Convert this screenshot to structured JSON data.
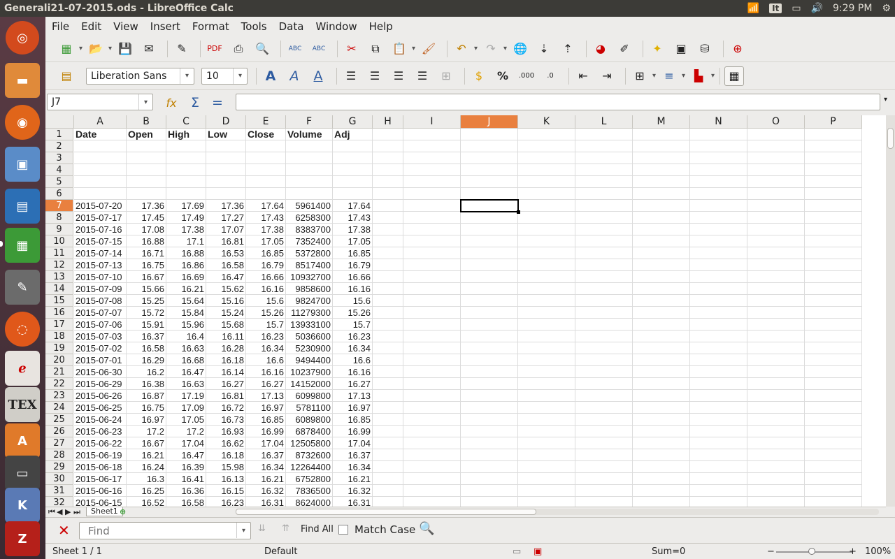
{
  "window": {
    "title": "Generali21-07-2015.ods - LibreOffice Calc",
    "tray": {
      "keyboard": "It",
      "clock": "9:29 PM"
    }
  },
  "menu": [
    "File",
    "Edit",
    "View",
    "Insert",
    "Format",
    "Tools",
    "Data",
    "Window",
    "Help"
  ],
  "format_bar": {
    "font_name": "Liberation Sans",
    "font_size": "10"
  },
  "name_box": "J7",
  "formula": "",
  "columns": [
    "A",
    "B",
    "C",
    "D",
    "E",
    "F",
    "G",
    "H",
    "I",
    "J",
    "K",
    "L",
    "M",
    "N",
    "O",
    "P"
  ],
  "selected_column": "J",
  "selected_row": 7,
  "header_row": [
    "Date",
    "Open",
    "High",
    "Low",
    "Close",
    "Volume",
    "Adj"
  ],
  "row_numbers": [
    1,
    2,
    3,
    4,
    5,
    6,
    7,
    8,
    9,
    10,
    11,
    12,
    13,
    14,
    15,
    16,
    17,
    18,
    19,
    20,
    21,
    22,
    23,
    24,
    25,
    26,
    27,
    28,
    29,
    30,
    31,
    32
  ],
  "data_rows": [
    [
      "2015-07-20",
      "17.36",
      "17.69",
      "17.36",
      "17.64",
      "5961400",
      "17.64"
    ],
    [
      "2015-07-17",
      "17.45",
      "17.49",
      "17.27",
      "17.43",
      "6258300",
      "17.43"
    ],
    [
      "2015-07-16",
      "17.08",
      "17.38",
      "17.07",
      "17.38",
      "8383700",
      "17.38"
    ],
    [
      "2015-07-15",
      "16.88",
      "17.1",
      "16.81",
      "17.05",
      "7352400",
      "17.05"
    ],
    [
      "2015-07-14",
      "16.71",
      "16.88",
      "16.53",
      "16.85",
      "5372800",
      "16.85"
    ],
    [
      "2015-07-13",
      "16.75",
      "16.86",
      "16.58",
      "16.79",
      "8517400",
      "16.79"
    ],
    [
      "2015-07-10",
      "16.67",
      "16.69",
      "16.47",
      "16.66",
      "10932700",
      "16.66"
    ],
    [
      "2015-07-09",
      "15.66",
      "16.21",
      "15.62",
      "16.16",
      "9858600",
      "16.16"
    ],
    [
      "2015-07-08",
      "15.25",
      "15.64",
      "15.16",
      "15.6",
      "9824700",
      "15.6"
    ],
    [
      "2015-07-07",
      "15.72",
      "15.84",
      "15.24",
      "15.26",
      "11279300",
      "15.26"
    ],
    [
      "2015-07-06",
      "15.91",
      "15.96",
      "15.68",
      "15.7",
      "13933100",
      "15.7"
    ],
    [
      "2015-07-03",
      "16.37",
      "16.4",
      "16.11",
      "16.23",
      "5036600",
      "16.23"
    ],
    [
      "2015-07-02",
      "16.58",
      "16.63",
      "16.28",
      "16.34",
      "5230900",
      "16.34"
    ],
    [
      "2015-07-01",
      "16.29",
      "16.68",
      "16.18",
      "16.6",
      "9494400",
      "16.6"
    ],
    [
      "2015-06-30",
      "16.2",
      "16.47",
      "16.14",
      "16.16",
      "10237900",
      "16.16"
    ],
    [
      "2015-06-29",
      "16.38",
      "16.63",
      "16.27",
      "16.27",
      "14152000",
      "16.27"
    ],
    [
      "2015-06-26",
      "16.87",
      "17.19",
      "16.81",
      "17.13",
      "6099800",
      "17.13"
    ],
    [
      "2015-06-25",
      "16.75",
      "17.09",
      "16.72",
      "16.97",
      "5781100",
      "16.97"
    ],
    [
      "2015-06-24",
      "16.97",
      "17.05",
      "16.73",
      "16.85",
      "6089800",
      "16.85"
    ],
    [
      "2015-06-23",
      "17.2",
      "17.2",
      "16.93",
      "16.99",
      "6878400",
      "16.99"
    ],
    [
      "2015-06-22",
      "16.67",
      "17.04",
      "16.62",
      "17.04",
      "12505800",
      "17.04"
    ],
    [
      "2015-06-19",
      "16.21",
      "16.47",
      "16.18",
      "16.37",
      "8732600",
      "16.37"
    ],
    [
      "2015-06-18",
      "16.24",
      "16.39",
      "15.98",
      "16.34",
      "12264400",
      "16.34"
    ],
    [
      "2015-06-17",
      "16.3",
      "16.41",
      "16.13",
      "16.21",
      "6752800",
      "16.21"
    ],
    [
      "2015-06-16",
      "16.25",
      "16.36",
      "16.15",
      "16.32",
      "7836500",
      "16.32"
    ],
    [
      "2015-06-15",
      "16.52",
      "16.58",
      "16.23",
      "16.31",
      "8624000",
      "16.31"
    ]
  ],
  "sheet_tab": "Sheet1",
  "find_bar": {
    "placeholder": "Find",
    "find_all": "Find All",
    "match_case": "Match Case"
  },
  "status": {
    "sheet": "Sheet 1 / 1",
    "style": "Default",
    "sum": "Sum=0",
    "zoom": "100%"
  }
}
